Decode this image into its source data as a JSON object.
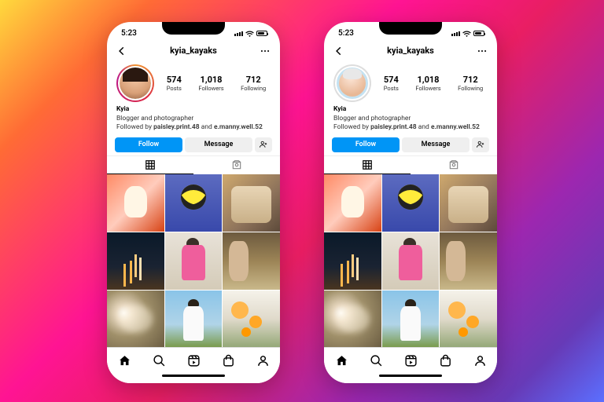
{
  "status": {
    "time": "5:23"
  },
  "header": {
    "username": "kyia_kayaks"
  },
  "profile": {
    "name": "Kyia",
    "desc": "Blogger and photographer",
    "followed_prefix": "Followed by ",
    "followed_1": "paisley.print.48",
    "followed_and": " and ",
    "followed_2": "e.manny.well.52",
    "stats": {
      "posts_n": "574",
      "posts_l": "Posts",
      "followers_n": "1,018",
      "followers_l": "Followers",
      "following_n": "712",
      "following_l": "Following"
    }
  },
  "actions": {
    "follow": "Follow",
    "message": "Message"
  },
  "phones": {
    "left": {
      "avatar_style": "photo_with_story_ring"
    },
    "right": {
      "avatar_style": "3d_avatar_no_ring"
    }
  }
}
